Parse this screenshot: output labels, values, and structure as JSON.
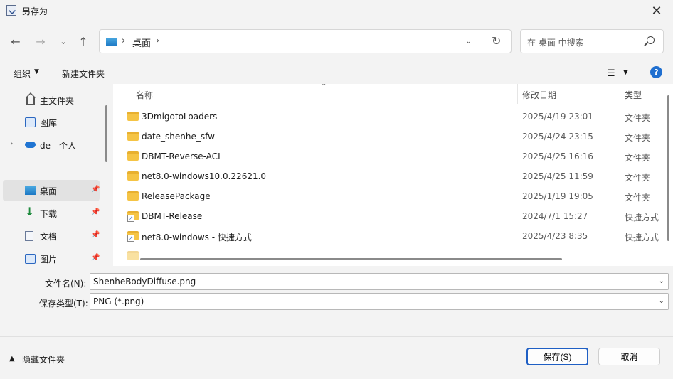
{
  "window": {
    "title": "另存为",
    "close_glyph": "✕"
  },
  "nav": {
    "back_glyph": "←",
    "forward_glyph": "→",
    "recent_glyph": "⌄",
    "up_glyph": "↑",
    "address": {
      "separator": "›",
      "crumb": "桌面",
      "dropdown_glyph": "⌄",
      "refresh_glyph": "↻"
    },
    "search": {
      "placeholder": "在 桌面 中搜索"
    }
  },
  "toolbar": {
    "organize": "组织",
    "caret": "▼",
    "new_folder": "新建文件夹",
    "view_glyph": "☰",
    "view_caret": "▼",
    "help": "?"
  },
  "sidebar": {
    "items": [
      {
        "label": "主文件夹",
        "icon": "home-icon"
      },
      {
        "label": "图库",
        "icon": "gallery-icon"
      },
      {
        "label": "de - 个人",
        "icon": "onedrive-icon",
        "expander": "›"
      },
      {
        "label": "桌面",
        "icon": "desktop-icon",
        "pinned": true,
        "selected": true
      },
      {
        "label": "下载",
        "icon": "download-icon",
        "pinned": true
      },
      {
        "label": "文档",
        "icon": "documents-icon",
        "pinned": true
      },
      {
        "label": "图片",
        "icon": "pictures-icon",
        "pinned": true
      }
    ],
    "pin_glyph": "📌"
  },
  "columns": {
    "name": "名称",
    "date": "修改日期",
    "type": "类型",
    "sort_glyph": "⌃"
  },
  "files": [
    {
      "name": "3DmigotoLoaders",
      "date": "2025/4/19 23:01",
      "type": "文件夹",
      "kind": "folder"
    },
    {
      "name": "date_shenhe_sfw",
      "date": "2025/4/24 23:15",
      "type": "文件夹",
      "kind": "folder"
    },
    {
      "name": "DBMT-Reverse-ACL",
      "date": "2025/4/25 16:16",
      "type": "文件夹",
      "kind": "folder"
    },
    {
      "name": "net8.0-windows10.0.22621.0",
      "date": "2025/4/25 11:59",
      "type": "文件夹",
      "kind": "folder"
    },
    {
      "name": "ReleasePackage",
      "date": "2025/1/19 19:05",
      "type": "文件夹",
      "kind": "folder"
    },
    {
      "name": "DBMT-Release",
      "date": "2024/7/1 15:27",
      "type": "快捷方式",
      "kind": "shortcut"
    },
    {
      "name": "net8.0-windows - 快捷方式",
      "date": "2025/4/23 8:35",
      "type": "快捷方式",
      "kind": "shortcut"
    }
  ],
  "form": {
    "filename_label": "文件名(N):",
    "filename_value": "ShenheBodyDiffuse.png",
    "filetype_label": "保存类型(T):",
    "filetype_value": "PNG (*.png)",
    "dropdown_glyph": "⌄"
  },
  "footer": {
    "hide_folders": "隐藏文件夹",
    "hide_caret": "▲",
    "save": "保存(S)",
    "cancel": "取消"
  }
}
